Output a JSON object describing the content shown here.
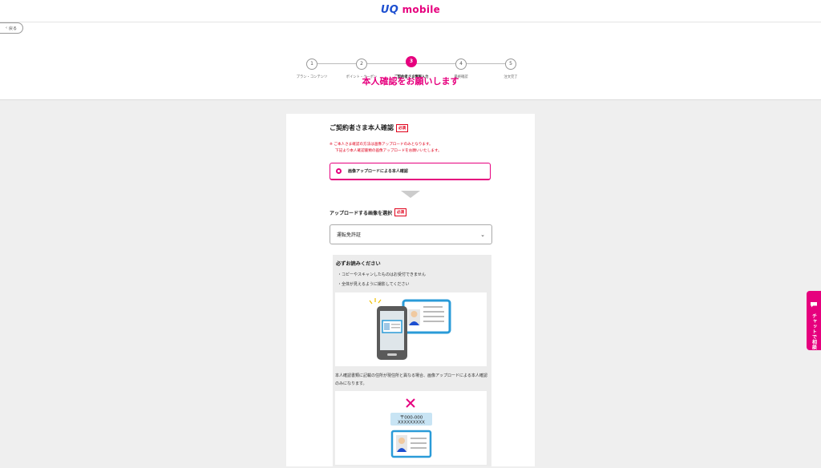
{
  "brand": {
    "logo_uq": "UQ",
    "logo_mobile": "mobile"
  },
  "nav": {
    "back_label": "戻る"
  },
  "steps": [
    {
      "num": "1",
      "label": "プラン・コンテンツ"
    },
    {
      "num": "2",
      "label": "ポイント・クーポン"
    },
    {
      "num": "3",
      "label": "ご契約者さま情報入力",
      "active": true
    },
    {
      "num": "4",
      "label": "最終確認"
    },
    {
      "num": "5",
      "label": "注文完了"
    }
  ],
  "page_title": "本人確認をお願いします",
  "section": {
    "title": "ご契約者さま本人確認",
    "required": "必須",
    "note_line1": "※ ご本人さま確認の方法は画像アップロードのみとなります。",
    "note_line2": "下記より本人確認書類の画像アップロードをお願いいたします。",
    "radio_label": "画像アップロードによる本人確認"
  },
  "upload": {
    "title": "アップロードする画像を選択",
    "required": "必須",
    "selected": "運転免許証"
  },
  "info": {
    "title": "必ずお読みください",
    "bullet1": "・コピーやスキャンしたものはお受付できません",
    "bullet2": "・全体が見えるように撮影してください",
    "caption": "本人確認書類に記載の住所が現住所と異なる場合、画像アップロードによる本人確認のみになります。",
    "address_line1": "〒000-000",
    "address_line2": "XXXXXXXXX"
  },
  "chat": {
    "label": "チャットで相談"
  },
  "colors": {
    "accent": "#e6007e",
    "brand_blue": "#1d4fd0",
    "warning": "#e0001b"
  }
}
